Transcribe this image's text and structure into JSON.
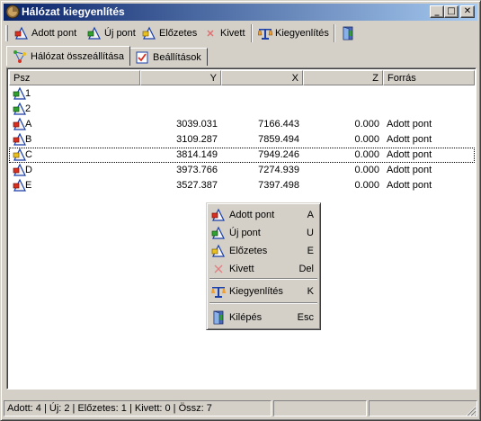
{
  "window": {
    "title": "Hálózat kiegyenlítés",
    "controls": {
      "minimize": "_",
      "maximize": "□",
      "close": "✕"
    }
  },
  "toolbar": {
    "items": [
      {
        "label": "Adott pont",
        "icon": "fixed-point-icon"
      },
      {
        "label": "Új pont",
        "icon": "new-point-icon"
      },
      {
        "label": "Előzetes",
        "icon": "preliminary-point-icon"
      },
      {
        "label": "Kivett",
        "icon": "removed-point-icon"
      },
      {
        "label": "Kiegyenlítés",
        "icon": "balance-scale-icon"
      },
      {
        "label": "",
        "icon": "exit-door-icon"
      }
    ]
  },
  "tabs": [
    {
      "label": "Hálózat összeállítása",
      "icon": "network-icon",
      "active": true
    },
    {
      "label": "Beállítások",
      "icon": "settings-checkbox-icon",
      "active": false
    }
  ],
  "table": {
    "columns": [
      "Psz",
      "Y",
      "X",
      "Z",
      "Forrás"
    ],
    "rows": [
      {
        "psz": "1",
        "y": "",
        "x": "",
        "z": "",
        "forras": "",
        "icon": "new-point-icon"
      },
      {
        "psz": "2",
        "y": "",
        "x": "",
        "z": "",
        "forras": "",
        "icon": "new-point-icon"
      },
      {
        "psz": "A",
        "y": "3039.031",
        "x": "7166.443",
        "z": "0.000",
        "forras": "Adott pont",
        "icon": "fixed-point-icon"
      },
      {
        "psz": "B",
        "y": "3109.287",
        "x": "7859.494",
        "z": "0.000",
        "forras": "Adott pont",
        "icon": "fixed-point-icon"
      },
      {
        "psz": "C",
        "y": "3814.149",
        "x": "7949.246",
        "z": "0.000",
        "forras": "Adott pont",
        "icon": "preliminary-point-icon",
        "focused": true
      },
      {
        "psz": "D",
        "y": "3973.766",
        "x": "7274.939",
        "z": "0.000",
        "forras": "Adott pont",
        "icon": "fixed-point-icon"
      },
      {
        "psz": "E",
        "y": "3527.387",
        "x": "7397.498",
        "z": "0.000",
        "forras": "Adott pont",
        "icon": "fixed-point-icon"
      }
    ]
  },
  "context_menu": {
    "items": [
      {
        "label": "Adott pont",
        "shortcut": "A",
        "icon": "fixed-point-icon"
      },
      {
        "label": "Új pont",
        "shortcut": "U",
        "icon": "new-point-icon"
      },
      {
        "label": "Előzetes",
        "shortcut": "E",
        "icon": "preliminary-point-icon"
      },
      {
        "label": "Kivett",
        "shortcut": "Del",
        "icon": "removed-point-icon"
      },
      {
        "label": "Kiegyenlítés",
        "shortcut": "K",
        "icon": "balance-scale-icon"
      },
      {
        "label": "Kilépés",
        "shortcut": "Esc",
        "icon": "exit-door-icon"
      }
    ]
  },
  "statusbar": {
    "summary": "Adott: 4 | Új: 2 | Előzetes: 1 | Kivett: 0 | Össz: 7",
    "panel2": "",
    "panel3": ""
  },
  "colors": {
    "titlebar_start": "#0a246a",
    "titlebar_end": "#a6caf0",
    "face": "#d4d0c8",
    "fixed_marker": "#d83020",
    "new_marker": "#30a030",
    "preliminary_marker": "#e8c020"
  }
}
